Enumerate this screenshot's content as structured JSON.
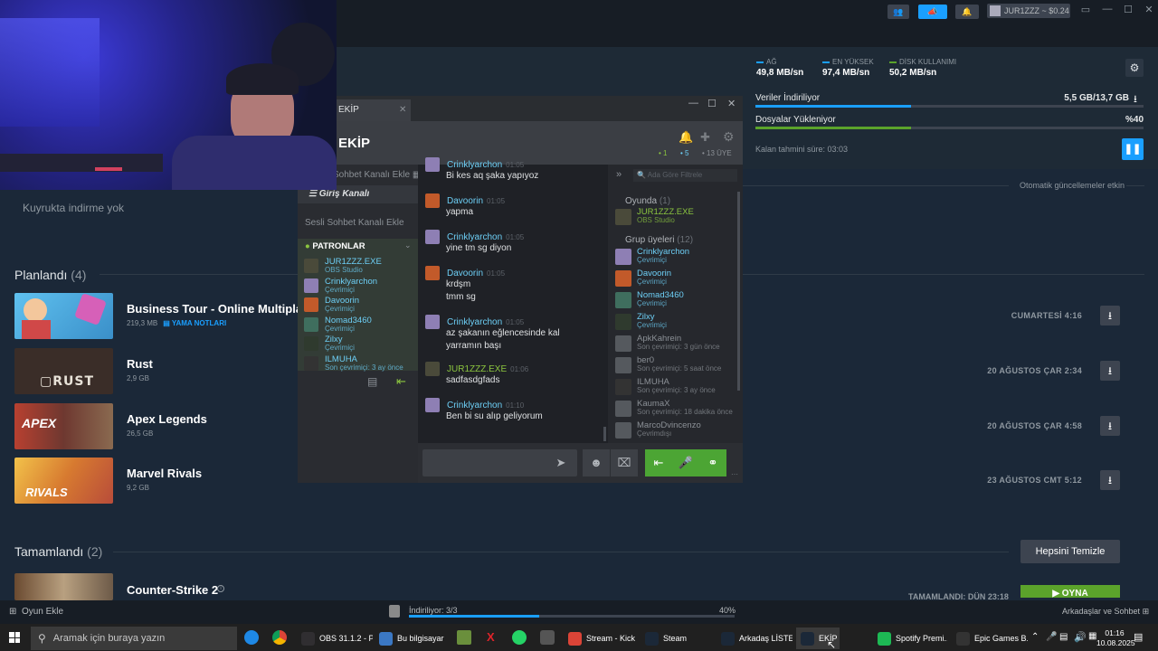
{
  "topbar": {
    "user_label": "JUR1ZZZ ~ $0.24",
    "icons": [
      "people-icon",
      "megaphone-icon",
      "bell-icon"
    ]
  },
  "stats": [
    {
      "label": "AĞ",
      "value": "49,8 MB/sn",
      "color": "#1a9fff"
    },
    {
      "label": "EN YÜKSEK",
      "value": "97,4 MB/sn",
      "color": "#1a9fff"
    },
    {
      "label": "DİSK KULLANIMI",
      "value": "50,2 MB/sn",
      "color": "#5ba32b"
    }
  ],
  "progress": {
    "download_label": "Veriler İndiriliyor",
    "download_value": "5,5 GB/13,7 GB",
    "download_fraction": 0.4,
    "upload_label": "Dosyalar Yükleniyor",
    "upload_value": "%40",
    "upload_fraction": 0.4,
    "remaining_label": "Kalan tahmini süre: 03:03"
  },
  "queue": {
    "auto_updates": "Otomatik güncellemeler etkin",
    "empty_text": "Kuyrukta indirme yok"
  },
  "planned": {
    "title": "Planlandı",
    "count": "(4)",
    "games": [
      {
        "name": "Business Tour - Online Multiplaye",
        "size": "219,3 MB",
        "note": "YAMA NOTLARI",
        "date": "CUMARTESİ 4:16",
        "color": "#4aa8d8"
      },
      {
        "name": "Rust",
        "size": "2,9 GB",
        "note": "",
        "date": "20 AĞUSTOS ÇAR 2:34",
        "color": "#3a2d28"
      },
      {
        "name": "Apex Legends",
        "size": "26,5 GB",
        "note": "",
        "date": "20 AĞUSTOS ÇAR 4:58",
        "color": "#a3382c"
      },
      {
        "name": "Marvel Rivals",
        "size": "9,2 GB",
        "note": "",
        "date": "23 AĞUSTOS CMT 5:12",
        "color": "#d9a23a"
      }
    ]
  },
  "completed": {
    "title": "Tamamlandı",
    "count": "(2)",
    "clear_label": "Hepsini Temizle",
    "game_name": "Counter-Strike 2",
    "date_partial": "TAMAMLANDI: DÜN 23:18",
    "play_label": "OYNA"
  },
  "bottombar": {
    "add_game": "Oyun Ekle",
    "downloading": "İndiriliyor: 3/3",
    "percent": "40%",
    "percent_fraction": 0.4,
    "friends_chat": "Arkadaşlar ve Sohbet"
  },
  "chat": {
    "tab_title": "EKİP",
    "group_title": "EKİP",
    "counts": {
      "ingame": "1",
      "online": "5",
      "members": "13 ÜYE"
    },
    "add_text_channel": "Sohbet Kanalı Ekle",
    "entry_channel": "Giriş Kanalı",
    "add_voice_channel": "Sesli Sohbet Kanalı Ekle",
    "voice_group": "PATRONLAR",
    "voice_members": [
      {
        "name": "JUR1ZZZ.EXE",
        "status": "OBS Studio",
        "state": "ingame",
        "color": "#4a4a3a"
      },
      {
        "name": "Crinklyarchon",
        "status": "Çevrimiçi",
        "state": "online",
        "color": "#8e7fb4"
      },
      {
        "name": "Davoorin",
        "status": "Çevrimiçi",
        "state": "online",
        "color": "#c25a2a"
      },
      {
        "name": "Nomad3460",
        "status": "Çevrimiçi",
        "state": "online",
        "color": "#3f6e5e"
      },
      {
        "name": "Zilxy",
        "status": "Çevrimiçi",
        "state": "online",
        "color": "#2f3a2e"
      },
      {
        "name": "ILMUHA",
        "status": "Son çevrimiçi: 3 ay önce",
        "state": "off",
        "color": "#333"
      }
    ],
    "search_placeholder": "Ada Göre Filtrele",
    "messages": [
      {
        "name": "Crinklyarchon",
        "time": "01:05",
        "text": "Bi kes aq şaka yapıyoz",
        "state": "online",
        "color": "#8e7fb4"
      },
      {
        "name": "Davoorin",
        "time": "01:05",
        "text": "yapma",
        "state": "online",
        "color": "#c25a2a"
      },
      {
        "name": "Crinklyarchon",
        "time": "01:05",
        "text": "yine tm sg diyon",
        "state": "online",
        "color": "#8e7fb4"
      },
      {
        "name": "Davoorin",
        "time": "01:05",
        "text": "krdşm\ntmm sg",
        "state": "online",
        "color": "#c25a2a"
      },
      {
        "name": "Crinklyarchon",
        "time": "01:05",
        "text": "az şakanın eğlencesinde kal\nyarramın başı",
        "state": "online",
        "color": "#8e7fb4"
      },
      {
        "name": "JUR1ZZZ.EXE",
        "time": "01:06",
        "text": "sadfasdgfads",
        "state": "ingame",
        "color": "#4a4a3a"
      },
      {
        "name": "Crinklyarchon",
        "time": "01:10",
        "text": "Ben bi su alıp geliyorum",
        "state": "online",
        "color": "#8e7fb4"
      }
    ],
    "ingame_header": "Oyunda",
    "ingame_count": "(1)",
    "members_header": "Grup üyeleri",
    "members_count": "(12)",
    "members": [
      {
        "name": "JUR1ZZZ.EXE",
        "status": "OBS Studio",
        "state": "ingame",
        "color": "#4a4a3a"
      },
      {
        "name": "Crinklyarchon",
        "status": "Çevrimiçi",
        "state": "online",
        "color": "#8e7fb4"
      },
      {
        "name": "Davoorin",
        "status": "Çevrimiçi",
        "state": "online",
        "color": "#c25a2a"
      },
      {
        "name": "Nomad3460",
        "status": "Çevrimiçi",
        "state": "online",
        "color": "#3f6e5e"
      },
      {
        "name": "Zilxy",
        "status": "Çevrimiçi",
        "state": "online",
        "color": "#2f3a2e"
      },
      {
        "name": "ApkKahrein",
        "status": "Son çevrimiçi: 3 gün önce",
        "state": "off",
        "color": "#55595e"
      },
      {
        "name": "ber0",
        "status": "Son çevrimiçi: 5 saat önce",
        "state": "off",
        "color": "#55595e"
      },
      {
        "name": "ILMUHA",
        "status": "Son çevrimiçi: 3 ay önce",
        "state": "off",
        "color": "#333"
      },
      {
        "name": "KaumaX",
        "status": "Son çevrimiçi: 18 dakika önce",
        "state": "off",
        "color": "#55595e"
      },
      {
        "name": "MarcoDvincenzo",
        "status": "Çevrimdışı",
        "state": "off",
        "color": "#55595e"
      }
    ]
  },
  "taskbar": {
    "search_placeholder": "Aramak için buraya yazın",
    "apps": [
      {
        "label": "OBS 31.1.2 - P...",
        "icon": "obs-icon",
        "color": "#302e31"
      },
      {
        "label": "Bu bilgisayar",
        "icon": "folder-icon",
        "color": "#3b78c4"
      },
      {
        "label": "Stream - Kick ...",
        "icon": "chrome-icon",
        "color": "#db4437"
      },
      {
        "label": "Steam",
        "icon": "steam-icon",
        "color": "#1b2838"
      },
      {
        "label": "Arkadaş LİSTESİ",
        "icon": "steam-icon",
        "color": "#1b2838"
      },
      {
        "label": "EKİP",
        "icon": "steam-icon",
        "color": "#1b2838"
      },
      {
        "label": "Spotify Premi...",
        "icon": "spotify-icon",
        "color": "#1db954"
      },
      {
        "label": "Epic Games B...",
        "icon": "epic-icon",
        "color": "#333"
      }
    ],
    "time": "01:16",
    "date": "10.08.2025"
  }
}
